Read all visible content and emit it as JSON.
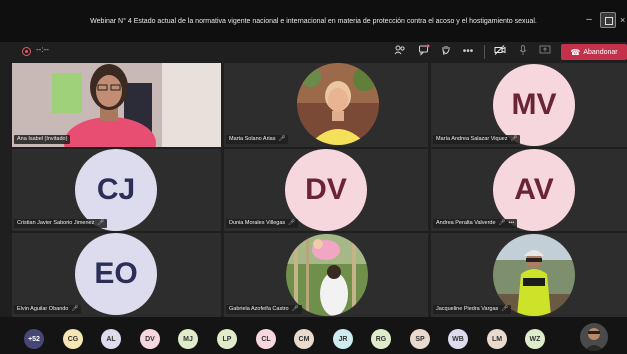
{
  "window": {
    "title": "Webinar N° 4 Estado actual de la normativa vigente nacional e internacional en materia de protección contra el acoso y el hostigamiento sexual.",
    "minimize_glyph": "–",
    "close_glyph": "×"
  },
  "toolbar": {
    "recording_time": "--:--",
    "more_glyph": "•••",
    "leave_label": "Abandonar",
    "leave_color": "#c4314b"
  },
  "participants": [
    {
      "name": "Ana Isabel (Invitado)",
      "video": true
    },
    {
      "name": "Marta Solano Arias",
      "video": true
    },
    {
      "name": "María Andrea Salazar Viquez",
      "initials": "MV",
      "color": "#f6d7de",
      "text_color": "#6b2436"
    },
    {
      "name": "Cristian Javier Saborio Jimenez",
      "initials": "CJ",
      "color": "#dcdcee",
      "text_color": "#2b2f57"
    },
    {
      "name": "Dunia Morales Villegas",
      "initials": "DV",
      "color": "#f6d7de",
      "text_color": "#6b2436"
    },
    {
      "name": "Andrea Peralta Valverde",
      "initials": "AV",
      "color": "#f6d7de",
      "text_color": "#6b2436"
    },
    {
      "name": "Elvin Aguilar Obando",
      "initials": "EO",
      "color": "#dcdcee",
      "text_color": "#2b2f57"
    },
    {
      "name": "Gabriela Azofeifa Castro",
      "video": true
    },
    {
      "name": "Jacqueline Piedra Vargas",
      "video": true
    }
  ],
  "gallery": {
    "more_count": "+52",
    "avatars": [
      {
        "initials": "CG",
        "color": "#f5e6b3"
      },
      {
        "initials": "AL",
        "color": "#dcdcee"
      },
      {
        "initials": "DV",
        "color": "#f6d7de"
      },
      {
        "initials": "MJ",
        "color": "#dfeccb"
      },
      {
        "initials": "LP",
        "color": "#dfeccb"
      },
      {
        "initials": "CL",
        "color": "#f6d7de"
      },
      {
        "initials": "CM",
        "color": "#ead9cd"
      },
      {
        "initials": "JR",
        "color": "#cfeaf0"
      },
      {
        "initials": "RG",
        "color": "#dfeccb"
      },
      {
        "initials": "SP",
        "color": "#ead9cd"
      },
      {
        "initials": "WB",
        "color": "#dcdcee"
      },
      {
        "initials": "LM",
        "color": "#ead9cd"
      },
      {
        "initials": "WZ",
        "color": "#dfeccb"
      }
    ]
  }
}
